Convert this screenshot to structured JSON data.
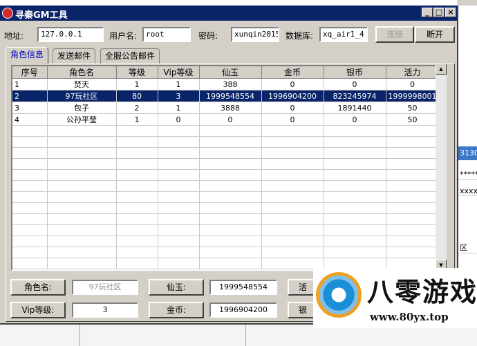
{
  "window": {
    "title": "寻秦GM工具"
  },
  "connection": {
    "address_label": "地址:",
    "address_value": "127.0.0.1",
    "username_label": "用户名:",
    "username_value": "root",
    "password_label": "密码:",
    "password_value": "xunqin2015",
    "database_label": "数据库:",
    "database_value": "xq_air1_4",
    "connect_label": "连接",
    "disconnect_label": "断开"
  },
  "tabs": [
    {
      "label": "角色信息",
      "active": true
    },
    {
      "label": "发送邮件",
      "active": false
    },
    {
      "label": "全服公告邮件",
      "active": false
    }
  ],
  "grid": {
    "columns": [
      "序号",
      "角色名",
      "等级",
      "Vip等级",
      "仙玉",
      "金币",
      "银币",
      "活力"
    ],
    "rows": [
      [
        "1",
        "焚天",
        "1",
        "1",
        "388",
        "0",
        "0",
        "0"
      ],
      [
        "2",
        "97玩社区",
        "80",
        "3",
        "1999548554",
        "1996904200",
        "823245974",
        "1999998001"
      ],
      [
        "3",
        "包子",
        "2",
        "1",
        "3888",
        "0",
        "1891440",
        "50"
      ],
      [
        "4",
        "公孙平莹",
        "1",
        "0",
        "0",
        "0",
        "0",
        "50"
      ]
    ],
    "selected_row": 1
  },
  "details": {
    "name_label": "角色名:",
    "name_value": "97玩社区",
    "xianyu_label": "仙玉:",
    "xianyu_value": "1999548554",
    "huoli_label_partial": "活",
    "vip_label": "Vip等级:",
    "vip_value": "3",
    "gold_label": "金币:",
    "gold_value": "1996904200",
    "silver_label_partial": "银"
  },
  "background_app": {
    "blue_text": "3130",
    "line1": "*****",
    "line2": "xxxx",
    "line3": "区"
  },
  "watermark": {
    "title": "八零游戏",
    "url": "www.80yx.top"
  }
}
